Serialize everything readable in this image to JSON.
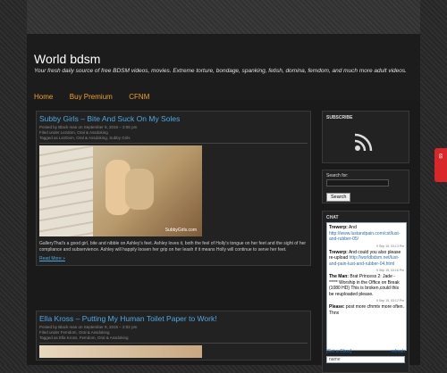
{
  "site": {
    "title": "World bdsm",
    "tagline": "Your fresh daily source of free BDSM videos, movies. Extreme torture, bondage, spanking, fetish, domina, femdom, and much more adult videos."
  },
  "nav": {
    "items": [
      "Home",
      "Buy Premium",
      "CFNM"
    ]
  },
  "posts": [
    {
      "title": "Subby Girls – Bite And Suck On My Soles",
      "meta_posted": "Posted by Black man on September 9, 2015 – 2:06 pm",
      "meta_filed": "Filed under Lezdom, Oral & Assdoking",
      "meta_tagged": "Tagged as LezDom, Oral & Assdoking, Subby Girls",
      "image_watermark": "SubbyGirls.com",
      "body": "GalleryThat's a good girl, bite and nibble on Ashley's feet. Ashley loves it, both the feel of Holly's tongue on her feet and the sight of her compliance and subservience. Ashley will happily loosen her grip on her leash if it means Holly will continue to serve her feet.",
      "read_more": "Read More »"
    },
    {
      "title": "Ella Kross – Putting My Human Toilet Paper to Work!",
      "meta_posted": "Posted by Black man on September 9, 2015 – 2:02 pm",
      "meta_filed": "Filed under Femdom, Oral & Assdoking",
      "meta_tagged": "Tagged as Ella Kross, Femdom, Oral & Assdoking"
    }
  ],
  "sidebar": {
    "subscribe_title": "SUBSCRIBE",
    "search_label": "Search for:",
    "search_button": "Search",
    "chat_title": "CHAT",
    "chat_messages": [
      {
        "user": "Trewerp:",
        "text": "And",
        "link": "http://www.lustandpain.com/cst/lust-and-rubber-05/"
      },
      {
        "time": "9 Sep 15, 03:13 Pm"
      },
      {
        "user": "Trewerp:",
        "text": "And could you also please re-upload",
        "link": "http://worldbdsm.net/lust-and-pain-lust-and-rubber-04.html"
      },
      {
        "time": "9 Sep 15, 03:16 Pm"
      },
      {
        "user": "The Man:",
        "text": "Brat Princess 2: Jade - ***** Worship in the Office on Break (1080 HD) This is broken,could this be reuploaded please."
      },
      {
        "time": "9 Sep 15, 03:12 Pm"
      },
      {
        "user": "Please:",
        "text": "post more cfnmtv more often. Thnx"
      }
    ],
    "chat_footer_left": "[Get a Cbox]",
    "chat_footer_right": "refresh",
    "chat_name_placeholder": "name"
  },
  "side_tab_label": "69",
  "colors": {
    "accent_orange": "#f0a020",
    "link_blue": "#4fa8e0",
    "tab_red": "#d9262a"
  }
}
